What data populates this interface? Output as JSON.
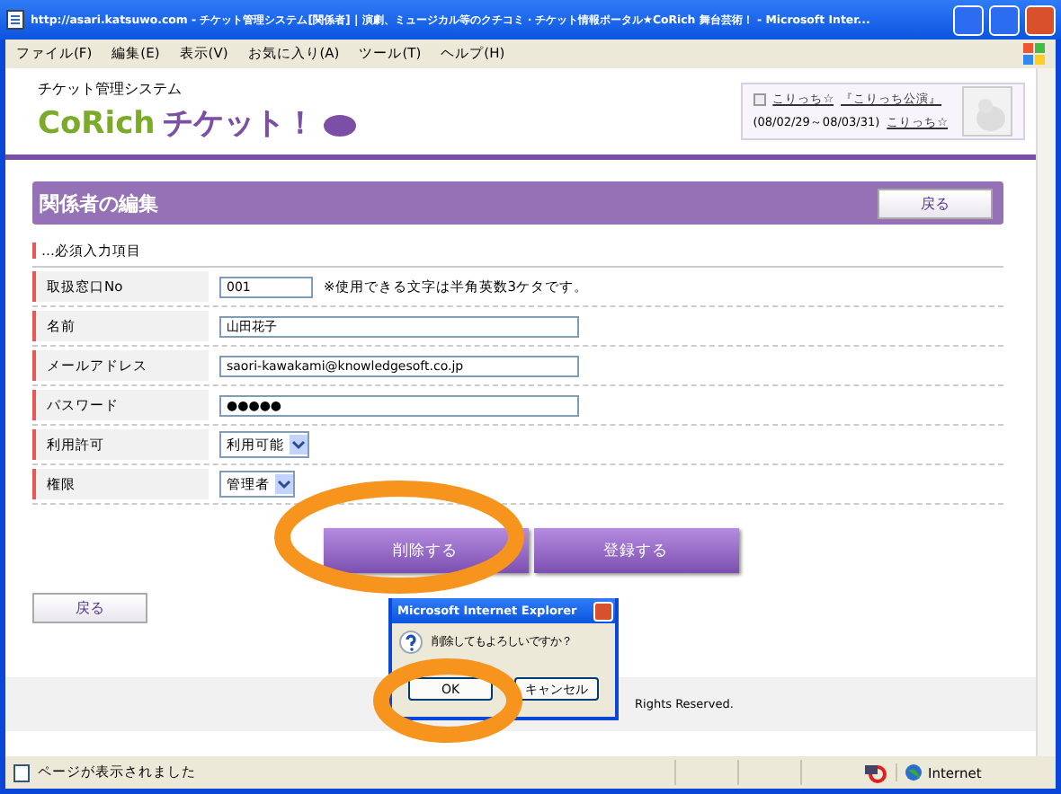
{
  "window": {
    "title": "http://asari.katsuwo.com - チケット管理システム[関係者] | 演劇、ミュージカル等のクチコミ・チケット情報ポータル★CoRich 舞台芸術！ - Microsoft Inter..."
  },
  "menu": [
    "ファイル(F)",
    "編集(E)",
    "表示(V)",
    "お気に入り(A)",
    "ツール(T)",
    "ヘルプ(H)"
  ],
  "header": {
    "subtitle": "チケット管理システム",
    "logo_latin": "CoRich",
    "logo_kana": "チケット！",
    "promo": {
      "link_1": "こりっち☆",
      "link_2": "『こりっち公演』",
      "period": "(08/02/29～08/03/31)",
      "link_3": "こりっち☆"
    }
  },
  "section": {
    "title": "関係者の編集",
    "back": "戻る"
  },
  "required_note": "…必須入力項目",
  "fields": [
    {
      "kind": "text",
      "label": "取扱窓口No",
      "value": "001",
      "hint": "※使用できる文字は半角英数3ケタです。",
      "short": true
    },
    {
      "kind": "text",
      "label": "名前",
      "value": "山田花子",
      "short": false
    },
    {
      "kind": "text",
      "label": "メールアドレス",
      "value": "saori-kawakami@knowledgesoft.co.jp",
      "short": false
    },
    {
      "kind": "text",
      "label": "パスワード",
      "value": "●●●●●",
      "short": false
    },
    {
      "kind": "select",
      "label": "利用許可",
      "value": "利用可能"
    },
    {
      "kind": "select",
      "label": "権限",
      "value": "管理者"
    }
  ],
  "actions": [
    "削除する",
    "登録する"
  ],
  "back": "戻る",
  "footer": "Rights Reserved.",
  "dialog": {
    "title": "Microsoft Internet Explorer",
    "message": "削除してもよろしいですか？",
    "buttons": [
      "OK",
      "キャンセル"
    ]
  },
  "status_bar": {
    "text": "ページが表示されました",
    "zone": "Internet"
  }
}
